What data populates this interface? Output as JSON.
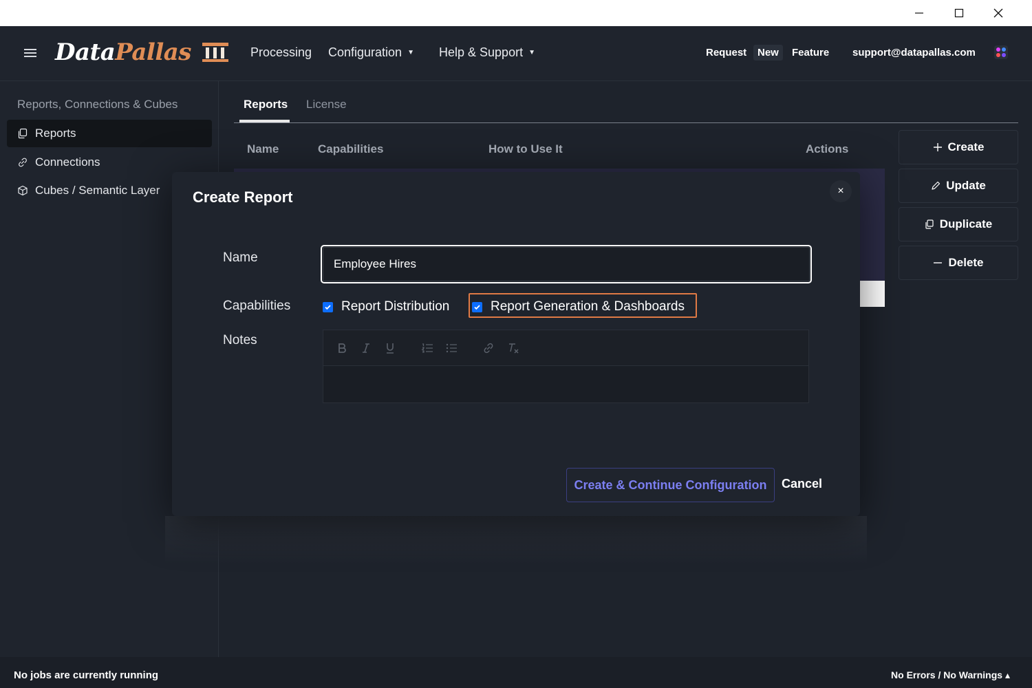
{
  "window": {
    "minimize_icon": "minimize-icon",
    "maximize_icon": "maximize-icon",
    "close_icon": "close-icon"
  },
  "header": {
    "logo_part1": "Data",
    "logo_part2": "Pallas",
    "nav": {
      "processing": "Processing",
      "configuration": "Configuration",
      "help": "Help & Support"
    },
    "feature_request": {
      "request": "Request",
      "new": "New",
      "feature": "Feature"
    },
    "support_email": "support@datapallas.com",
    "colors": {
      "logo_accent": "#e08d55"
    }
  },
  "sidebar": {
    "title": "Reports, Connections & Cubes",
    "items": [
      {
        "label": "Reports",
        "icon": "copy-icon",
        "active": true
      },
      {
        "label": "Connections",
        "icon": "link-icon",
        "active": false
      },
      {
        "label": "Cubes / Semantic Layer",
        "icon": "cube-icon",
        "active": false
      }
    ]
  },
  "main": {
    "tabs": [
      {
        "label": "Reports",
        "active": true
      },
      {
        "label": "License",
        "active": false
      }
    ],
    "table": {
      "columns": [
        "Name",
        "Capabilities",
        "How to Use It",
        "Actions"
      ]
    },
    "actions": {
      "create": "Create",
      "update": "Update",
      "duplicate": "Duplicate",
      "delete": "Delete"
    }
  },
  "modal": {
    "title": "Create Report",
    "close": "×",
    "name_label": "Name",
    "name_value": "Employee Hires",
    "capabilities_label": "Capabilities",
    "capabilities": [
      {
        "label": "Report Distribution",
        "checked": true
      },
      {
        "label": "Report Generation & Dashboards",
        "checked": true
      }
    ],
    "notes_label": "Notes",
    "editor_tools": [
      "bold-icon",
      "italic-icon",
      "underline-icon",
      "ordered-list-icon",
      "bullet-list-icon",
      "link-icon",
      "clear-format-icon"
    ],
    "primary_button": "Create & Continue Configuration",
    "cancel_button": "Cancel",
    "colors": {
      "primary_text": "#7c7ff2",
      "focus_outline": "#e07a45",
      "checkbox": "#0d6efd"
    }
  },
  "status": {
    "left": "No jobs are currently running",
    "right": "No Errors / No Warnings ▴"
  }
}
